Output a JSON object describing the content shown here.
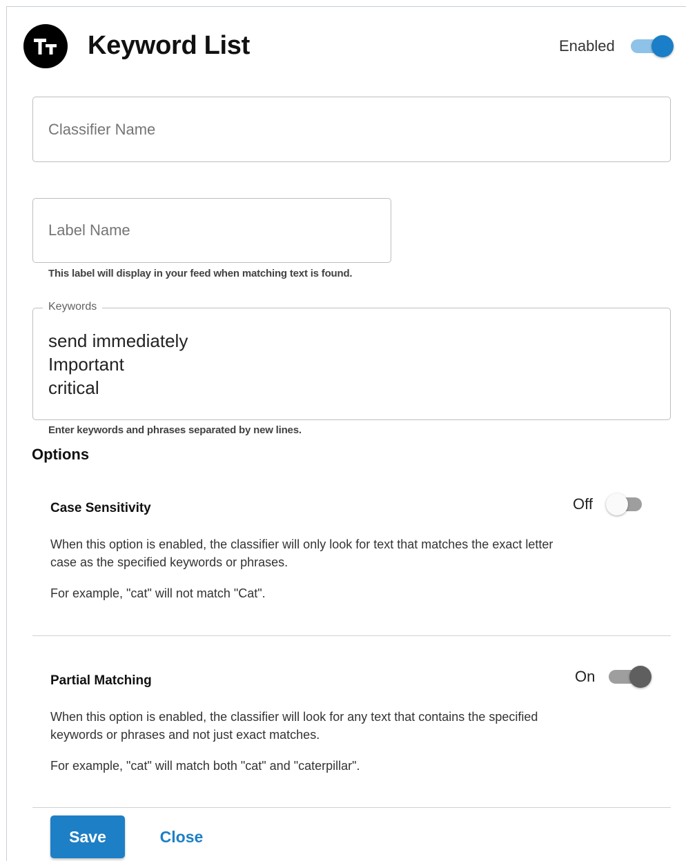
{
  "header": {
    "title": "Keyword List",
    "logo_icon": "text-size-icon",
    "enabled_label": "Enabled",
    "enabled": true
  },
  "fields": {
    "classifier_name": {
      "placeholder": "Classifier Name",
      "value": ""
    },
    "label_name": {
      "placeholder": "Label Name",
      "value": "",
      "helper": "This label will display in your feed when matching text is found."
    },
    "keywords": {
      "legend": "Keywords",
      "lines": [
        "send immediately",
        "Important",
        "critical"
      ],
      "helper": "Enter keywords and phrases separated by new lines."
    }
  },
  "options": {
    "heading": "Options",
    "case_sensitivity": {
      "title": "Case Sensitivity",
      "state_label": "Off",
      "enabled": false,
      "description": "When this option is enabled, the classifier will only look for text that matches the exact letter case as the specified keywords or phrases.",
      "example": "For example, \"cat\" will not match \"Cat\"."
    },
    "partial_matching": {
      "title": "Partial Matching",
      "state_label": "On",
      "enabled": true,
      "description": "When this option is enabled, the classifier will look for any text that contains the specified keywords or phrases and not just exact matches.",
      "example": "For example, \"cat\" will match both \"cat\" and \"caterpillar\"."
    }
  },
  "actions": {
    "save_label": "Save",
    "close_label": "Close"
  },
  "colors": {
    "accent": "#1d7fc6",
    "toggle_on_track": "#8fc2e8",
    "logo_bg": "#000000"
  }
}
